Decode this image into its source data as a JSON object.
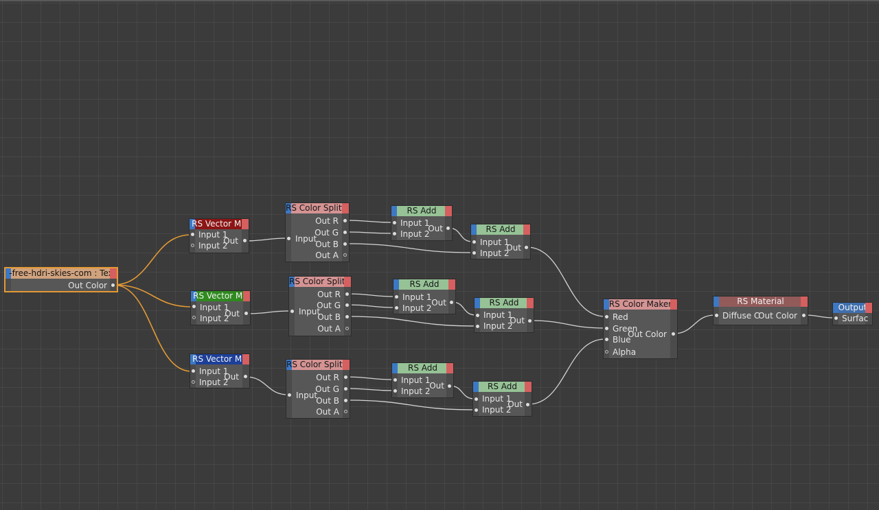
{
  "editor": {
    "texture": {
      "title": "-free-hdri-skies-com : Tex",
      "out": "Out Color"
    },
    "vector_mult_red": {
      "title": "RS Vector Mu",
      "in1": "Input 1",
      "in2": "Input 2",
      "out": "Out"
    },
    "vector_mult_green": {
      "title": "RS Vector Mu",
      "in1": "Input 1",
      "in2": "Input 2",
      "out": "Out"
    },
    "vector_mult_blue": {
      "title": "RS Vector Mu",
      "in1": "Input 1",
      "in2": "Input 2",
      "out": "Out"
    },
    "splitter_1": {
      "title": "RS Color Splitter",
      "in": "Input",
      "outs": [
        "Out R",
        "Out G",
        "Out B",
        "Out A"
      ]
    },
    "splitter_2": {
      "title": "RS Color Splitter",
      "in": "Input",
      "outs": [
        "Out R",
        "Out G",
        "Out B",
        "Out A"
      ]
    },
    "splitter_3": {
      "title": "RS Color Splitter",
      "in": "Input",
      "outs": [
        "Out R",
        "Out G",
        "Out B",
        "Out A"
      ]
    },
    "add_1a": {
      "title": "RS Add",
      "in1": "Input 1",
      "in2": "Input 2",
      "out": "Out"
    },
    "add_1b": {
      "title": "RS Add",
      "in1": "Input 1",
      "in2": "Input 2",
      "out": "Out"
    },
    "add_2a": {
      "title": "RS Add",
      "in1": "Input 1",
      "in2": "Input 2",
      "out": "Out"
    },
    "add_2b": {
      "title": "RS Add",
      "in1": "Input 1",
      "in2": "Input 2",
      "out": "Out"
    },
    "add_3a": {
      "title": "RS Add",
      "in1": "Input 1",
      "in2": "Input 2",
      "out": "Out"
    },
    "add_3b": {
      "title": "RS Add",
      "in1": "Input 1",
      "in2": "Input 2",
      "out": "Out"
    },
    "color_maker": {
      "title": "RS Color Maker",
      "ins": [
        "Red",
        "Green",
        "Blue",
        "Alpha"
      ],
      "out": "Out Color"
    },
    "material": {
      "title": "RS Material",
      "in": "Diffuse C",
      "out": "Out Color"
    },
    "output": {
      "title": "Output",
      "in": "Surfac"
    }
  },
  "colors": {
    "canvas": "#3b3b3b",
    "node_body": "#575757",
    "header_pink": "#d59393",
    "header_green": "#96c296",
    "header_red": "#8c1515",
    "header_green_dark": "#2f8a1f",
    "header_blue": "#1c3f98",
    "header_material": "#935a5a",
    "header_output": "#3f6fae",
    "header_texture": "#d0a27d",
    "selection": "#e49a34",
    "wire": "#d4d4d4"
  }
}
